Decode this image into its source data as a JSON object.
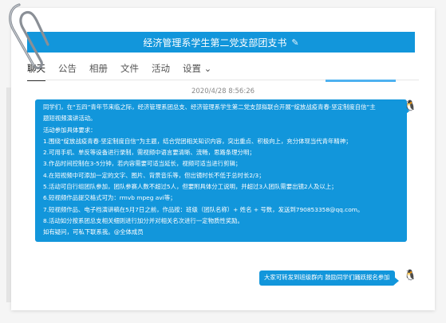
{
  "page": {
    "title": "经济管理系学生第二党支部团支书",
    "edit_icon": "✎"
  },
  "tabs": [
    {
      "label": "聊天"
    },
    {
      "label": "公告"
    },
    {
      "label": "相册"
    },
    {
      "label": "文件"
    },
    {
      "label": "活动"
    },
    {
      "label": "设置 ⌄"
    }
  ],
  "chat": {
    "timestamp": "2020/4/28 8:56:26",
    "message_lines": [
      "同学们，在“五四”青年节来临之际，经济管理系团总支、经济管理系学生第二党支部拟联合开展“绽放战疫青春·坚定制度自信”主",
      "题短视频演讲活动。",
      "活动参加具体要求：",
      "1.围绕“绽放战疫青春·坚定制度自信”为主题，结合党团相关知识内容，突出重点、积极向上，充分体现当代青年精神；",
      "2.可用手机、单反等设备进行录制，需视频中语言要清晰、流畅，思路条理分明；",
      "3.作品时间控制在3-5分钟，若内容需要可适当延长，视频可适当进行剪辑；",
      "4.在短视频中可添加一定的文字、图片、背景音乐等，但出镜时长不低于总时长2/3；",
      "5.活动可自行组团队参加，团队参赛人数不超过5人，但要附具体分工说明，并超过3人团队需要出镜2人及以上；",
      "6.短视频作品提交格式可为：rmvb mpeg avi等；",
      "7.短视频作品、电子档演讲稿在5月7日之前，作品按：班级（团队名称）+ 姓名 + 号数，发送到790853358@qq.com。",
      "8.活动如分按系团总支相关细则进行加分并对相关名次进行一定物质性奖励。",
      "如有疑问，可私下联系我。@全体成员"
    ],
    "reply_text": "大家可转发到班级群内 鼓励同学们踊跃报名参加"
  },
  "icons": {
    "avatar_icon": "🐧",
    "paperclip_icon": "paperclip"
  },
  "colors": {
    "accent": "#1296db",
    "bubble_text": "#ffffff"
  }
}
